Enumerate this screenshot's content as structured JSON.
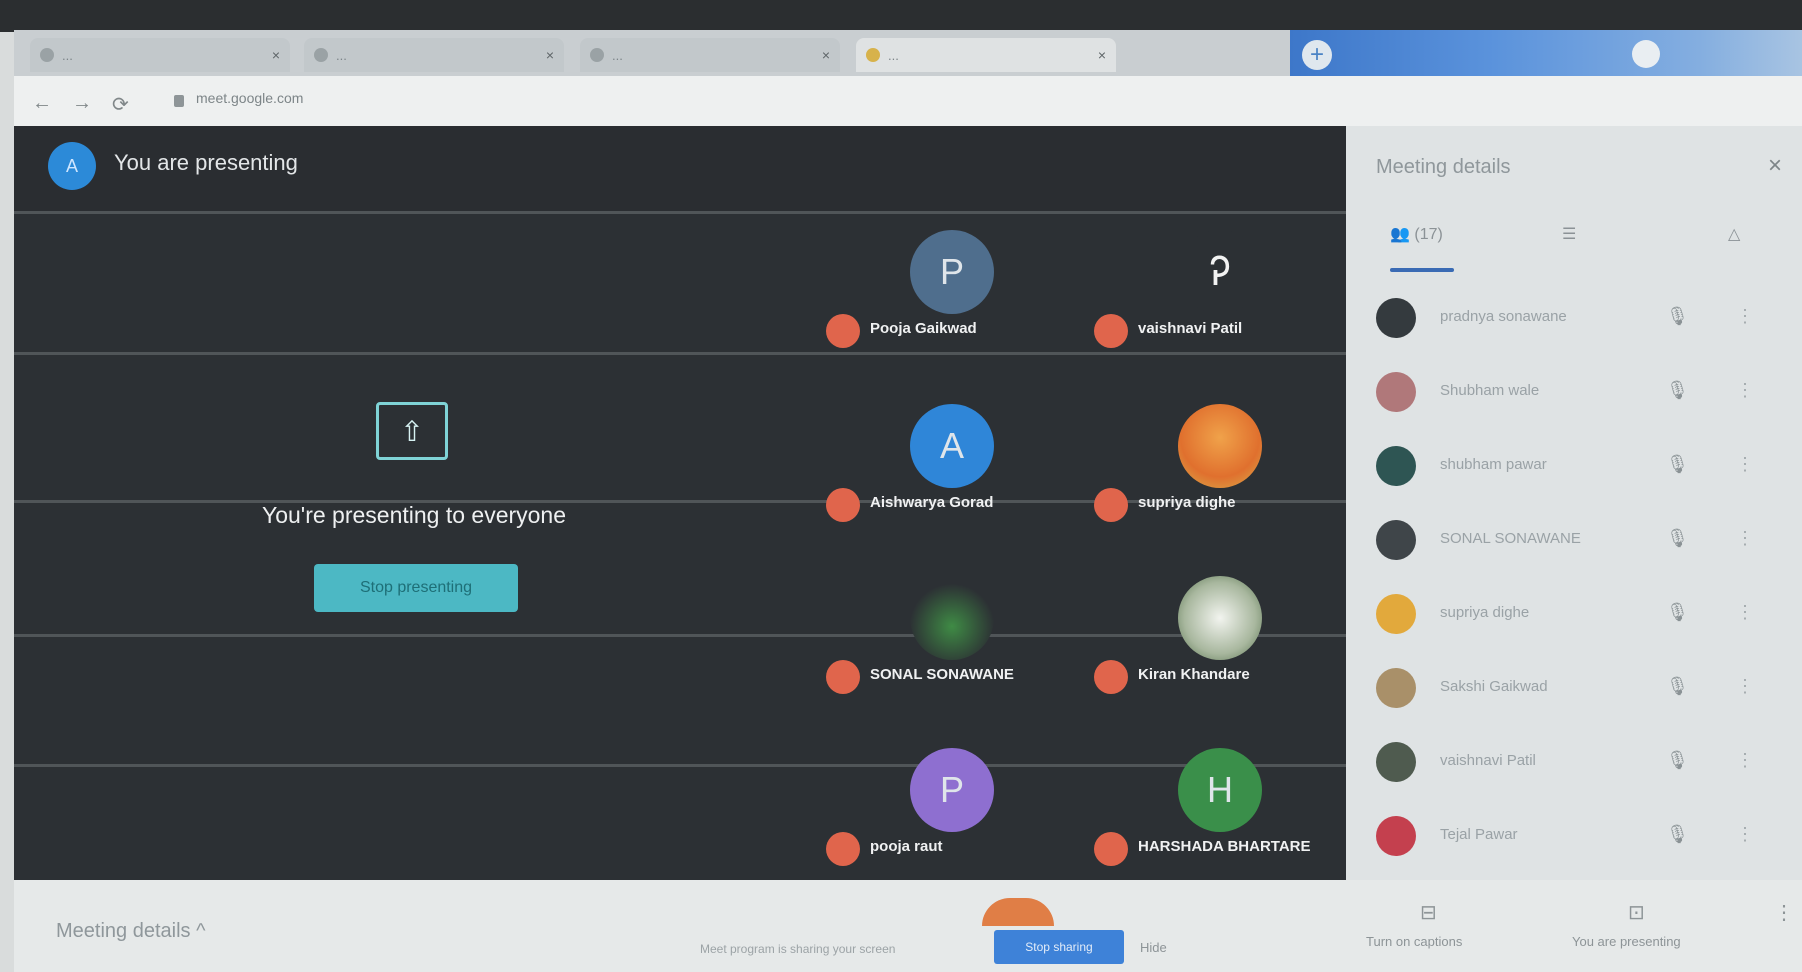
{
  "browser": {
    "tabs": [
      {
        "label": "...",
        "close": "×"
      },
      {
        "label": "...",
        "close": "×"
      },
      {
        "label": "...",
        "close": "×"
      },
      {
        "label": "...",
        "close": "×"
      }
    ],
    "new_tab": "+",
    "url": "meet.google.com",
    "nav": {
      "back": "←",
      "forward": "→",
      "reload": "⟳"
    }
  },
  "meeting": {
    "presenter_avatar": "A",
    "presenting_banner": "You are presenting",
    "present_message": "You're presenting to everyone",
    "stop_button": "Stop presenting",
    "participants_grid": [
      {
        "initial": "P",
        "name": "Pooja Gaikwad",
        "color": "#4f6e8d"
      },
      {
        "initial": "",
        "name": "vaishnavi Patil",
        "color": "#2c3034"
      },
      {
        "initial": "A",
        "name": "Aishwarya Gorad",
        "color": "#2f86d8"
      },
      {
        "initial": "",
        "name": "supriya dighe",
        "color": "#e07836"
      },
      {
        "initial": "",
        "name": "SONAL SONAWANE",
        "color": "#2c3034"
      },
      {
        "initial": "",
        "name": "Kiran Khandare",
        "color": "#cfd7c7"
      },
      {
        "initial": "P",
        "name": "pooja raut",
        "color": "#8e6fd0"
      },
      {
        "initial": "H",
        "name": "HARSHADA BHARTARE",
        "color": "#3a8f4a"
      }
    ]
  },
  "side_panel": {
    "title": "Meeting details",
    "close": "×",
    "tabs": [
      {
        "icon": "people-icon",
        "label": "(17)"
      },
      {
        "icon": "chat-icon",
        "label": "☰"
      },
      {
        "icon": "activities-icon",
        "label": "△"
      }
    ],
    "participants": [
      {
        "name": "pradnya sonawane",
        "color": "#343a3e"
      },
      {
        "name": "Shubham wale",
        "color": "#b0787a"
      },
      {
        "name": "shubham pawar",
        "color": "#2e5553"
      },
      {
        "name": "SONAL SONAWANE",
        "color": "#3f4549"
      },
      {
        "name": "supriya dighe",
        "color": "#e2a93c"
      },
      {
        "name": "Sakshi Gaikwad",
        "color": "#a99069"
      },
      {
        "name": "vaishnavi Patil",
        "color": "#4f5b4f"
      },
      {
        "name": "Tejal Pawar",
        "color": "#c4404e"
      }
    ]
  },
  "bottom_bar": {
    "meeting_details": "Meeting details",
    "chevron": "^",
    "hint": "Meet program is sharing your screen",
    "stop_sharing": "Stop sharing",
    "hide": "Hide",
    "captions_label": "Turn on captions",
    "presenting_label": "You are presenting",
    "more": "⋮"
  }
}
